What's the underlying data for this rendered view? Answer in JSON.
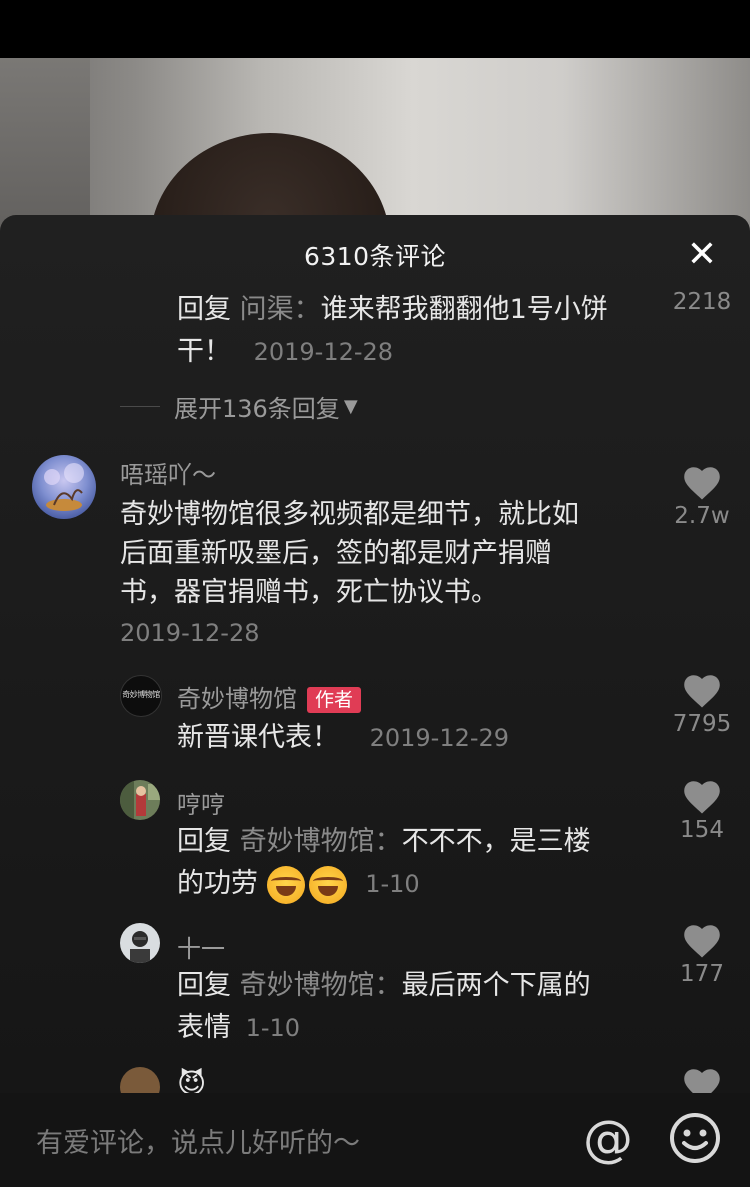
{
  "sheet": {
    "title": "6310条评论"
  },
  "prev_reply": {
    "prefix": "回复",
    "reply_to": "问渠：",
    "line1": "谁来帮我翻翻他1号小饼",
    "line2": "干！",
    "date": "2019-12-28",
    "likes": "2218"
  },
  "expand": {
    "label": "展开136条回复"
  },
  "comment": {
    "user": "唔瑶吖～",
    "lines": [
      "奇妙博物馆很多视频都是细节，就比如",
      "后面重新吸墨后，签的都是财产捐赠",
      "书，器官捐赠书，死亡协议书。"
    ],
    "date": "2019-12-28",
    "likes": "2.7w"
  },
  "replies": [
    {
      "user": "奇妙博物馆",
      "badge": "作者",
      "text": "新晋课代表！",
      "date": "2019-12-29",
      "likes": "7795",
      "avatar_text": "奇妙博物馆"
    },
    {
      "user": "哼哼",
      "prefix": "回复",
      "reply_to": "奇妙博物馆：",
      "line1": "不不不，是三楼",
      "line2": "的功劳",
      "date": "1-10",
      "likes": "154"
    },
    {
      "user": "十一",
      "prefix": "回复",
      "reply_to": "奇妙博物馆：",
      "line1": "最后两个下属的",
      "line2": "表情",
      "date": "1-10",
      "likes": "177"
    }
  ],
  "partial": {
    "user": "😈"
  },
  "input": {
    "placeholder": "有爱评论，说点儿好听的～",
    "at": "@"
  }
}
